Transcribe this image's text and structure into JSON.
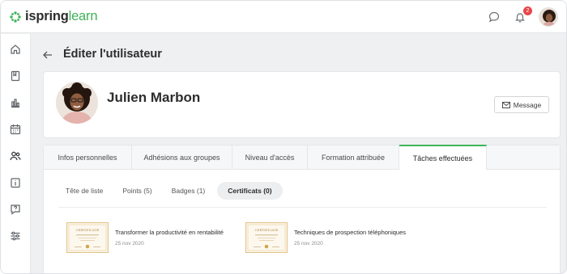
{
  "app": {
    "logo_main": "ispring",
    "logo_accent": "learn",
    "notification_count": "2"
  },
  "sidebar": {
    "items": [
      {
        "icon": "home-icon"
      },
      {
        "icon": "book-icon"
      },
      {
        "icon": "bar-chart-icon"
      },
      {
        "icon": "calendar-icon"
      },
      {
        "icon": "users-icon"
      },
      {
        "icon": "info-icon"
      },
      {
        "icon": "help-icon"
      },
      {
        "icon": "settings-sliders-icon"
      }
    ]
  },
  "page": {
    "title": "Éditer l'utilisateur"
  },
  "profile": {
    "name": "Julien Marbon",
    "message_button": "Message"
  },
  "tabs": [
    {
      "label": "Infos personnelles",
      "active": false
    },
    {
      "label": "Adhésions aux groupes",
      "active": false
    },
    {
      "label": "Niveau d'accès",
      "active": false
    },
    {
      "label": "Formation attribuée",
      "active": false
    },
    {
      "label": "Tâches effectuées",
      "active": true
    }
  ],
  "subtabs": [
    {
      "label": "Tête de liste",
      "active": false
    },
    {
      "label": "Points (5)",
      "active": false
    },
    {
      "label": "Badges (1)",
      "active": false
    },
    {
      "label": "Certificats (0)",
      "active": true
    }
  ],
  "certificates": [
    {
      "title": "Transformer la productivité en rentabilité",
      "date": "25 nov 2020",
      "thumb_label": "CERTIFICATE"
    },
    {
      "title": "Techniques de prospection téléphoniques",
      "date": "25 nov 2020",
      "thumb_label": "CERTIFICATE"
    }
  ],
  "colors": {
    "accent": "#3fb45a",
    "badge": "#e8474b",
    "certificate_border": "#e2c48a"
  }
}
